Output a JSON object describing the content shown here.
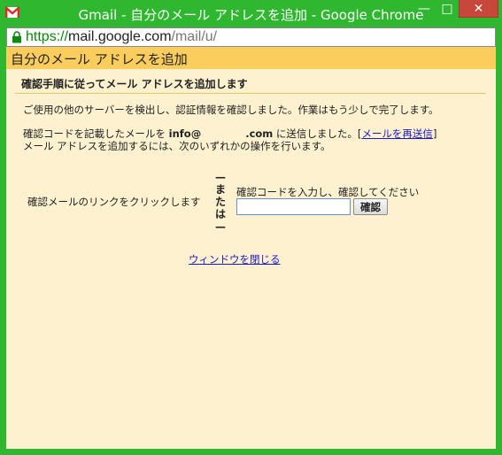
{
  "window": {
    "title": "Gmail - 自分のメール アドレスを追加 - Google Chrome",
    "app_icon": "gmail-icon",
    "controls": {
      "minimize_glyph": "—",
      "maximize_glyph": "□",
      "close_glyph": "✕"
    },
    "frame_color": "#2fb72f"
  },
  "address_bar": {
    "lock_icon": "lock-icon",
    "scheme": "https://",
    "host": "mail.google.com",
    "path": "/mail/u/"
  },
  "dialog": {
    "header_title": "自分のメール アドレスを追加",
    "step_heading": "確認手順に従ってメール アドレスを追加します",
    "intro": "ご使用の他のサーバーを検出し、認証情報を確認しました。作業はもう少しで完了します。",
    "sent_prefix": "確認コードを記載したメールを ",
    "email_user": "info@",
    "email_domain": ".com",
    "sent_suffix": " に送信しました。[",
    "resend_link": "メールを再送信",
    "bracket_close": "]",
    "instruction": "メール アドレスを追加するには、次のいずれかの操作を行います。",
    "option_link_text": "確認メールのリンクをクリックします",
    "or_text": [
      "—",
      "ま",
      "た",
      "は",
      "—"
    ],
    "code_label": "確認コードを入力し、確認してください",
    "code_input_value": "",
    "confirm_button": "確認",
    "close_link": "ウィンドウを閉じる"
  },
  "colors": {
    "header_band": "#fbcd5c",
    "content_bg": "#fdf1cf",
    "link": "#1a1acc"
  }
}
